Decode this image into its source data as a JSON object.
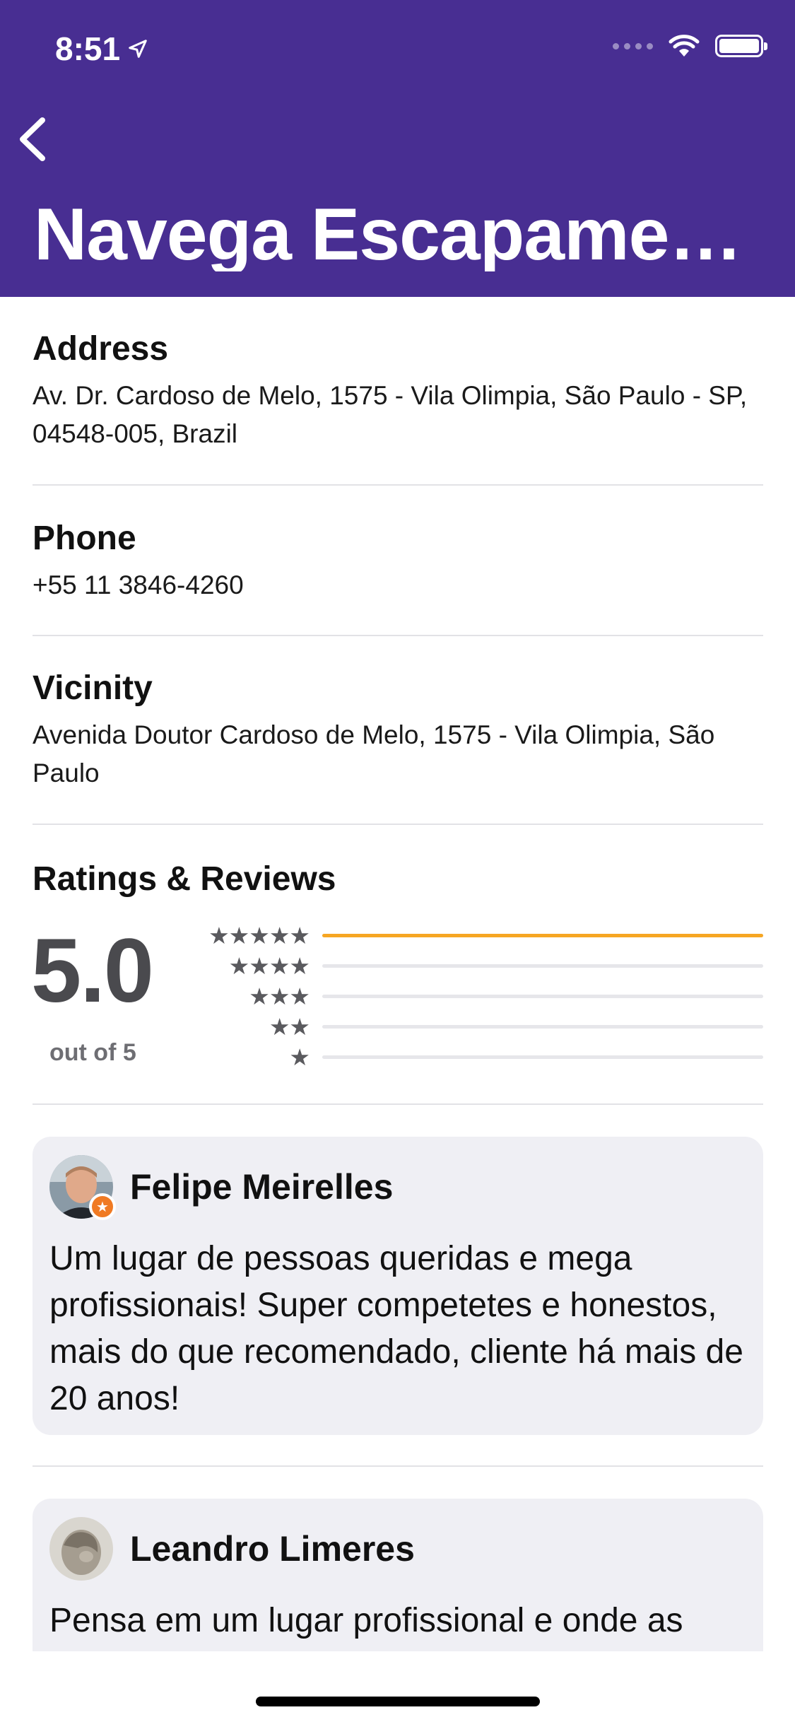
{
  "status_bar": {
    "time": "8:51"
  },
  "header": {
    "title": "Navega Escapamen...",
    "back_label": "Back"
  },
  "address": {
    "label": "Address",
    "value": "Av. Dr. Cardoso de Melo, 1575 - Vila Olimpia, São Paulo - SP, 04548-005, Brazil"
  },
  "phone": {
    "label": "Phone",
    "value": "+55 11 3846-4260"
  },
  "vicinity": {
    "label": "Vicinity",
    "value": "Avenida Doutor Cardoso de Melo, 1575 - Vila Olimpia, São Paulo"
  },
  "ratings": {
    "label": "Ratings & Reviews",
    "score": "5.0",
    "out_of": "out of 5",
    "rows": [
      {
        "stars": "★★★★★",
        "fraction": 1.0
      },
      {
        "stars": "★★★★",
        "fraction": 0
      },
      {
        "stars": "★★★",
        "fraction": 0
      },
      {
        "stars": "★★",
        "fraction": 0
      },
      {
        "stars": "★",
        "fraction": 0
      }
    ],
    "bar_color": "#f6a623"
  },
  "reviews": [
    {
      "author": "Felipe Meirelles",
      "text": "Um lugar de pessoas queridas e mega profissionais! Super competetes e honestos, mais do que recomendado, cliente há mais de 20 anos!"
    },
    {
      "author": "Leandro Limeres",
      "text": "Pensa em um lugar profissional e onde as"
    }
  ],
  "colors": {
    "header": "#482e92",
    "card": "#efeff4"
  }
}
